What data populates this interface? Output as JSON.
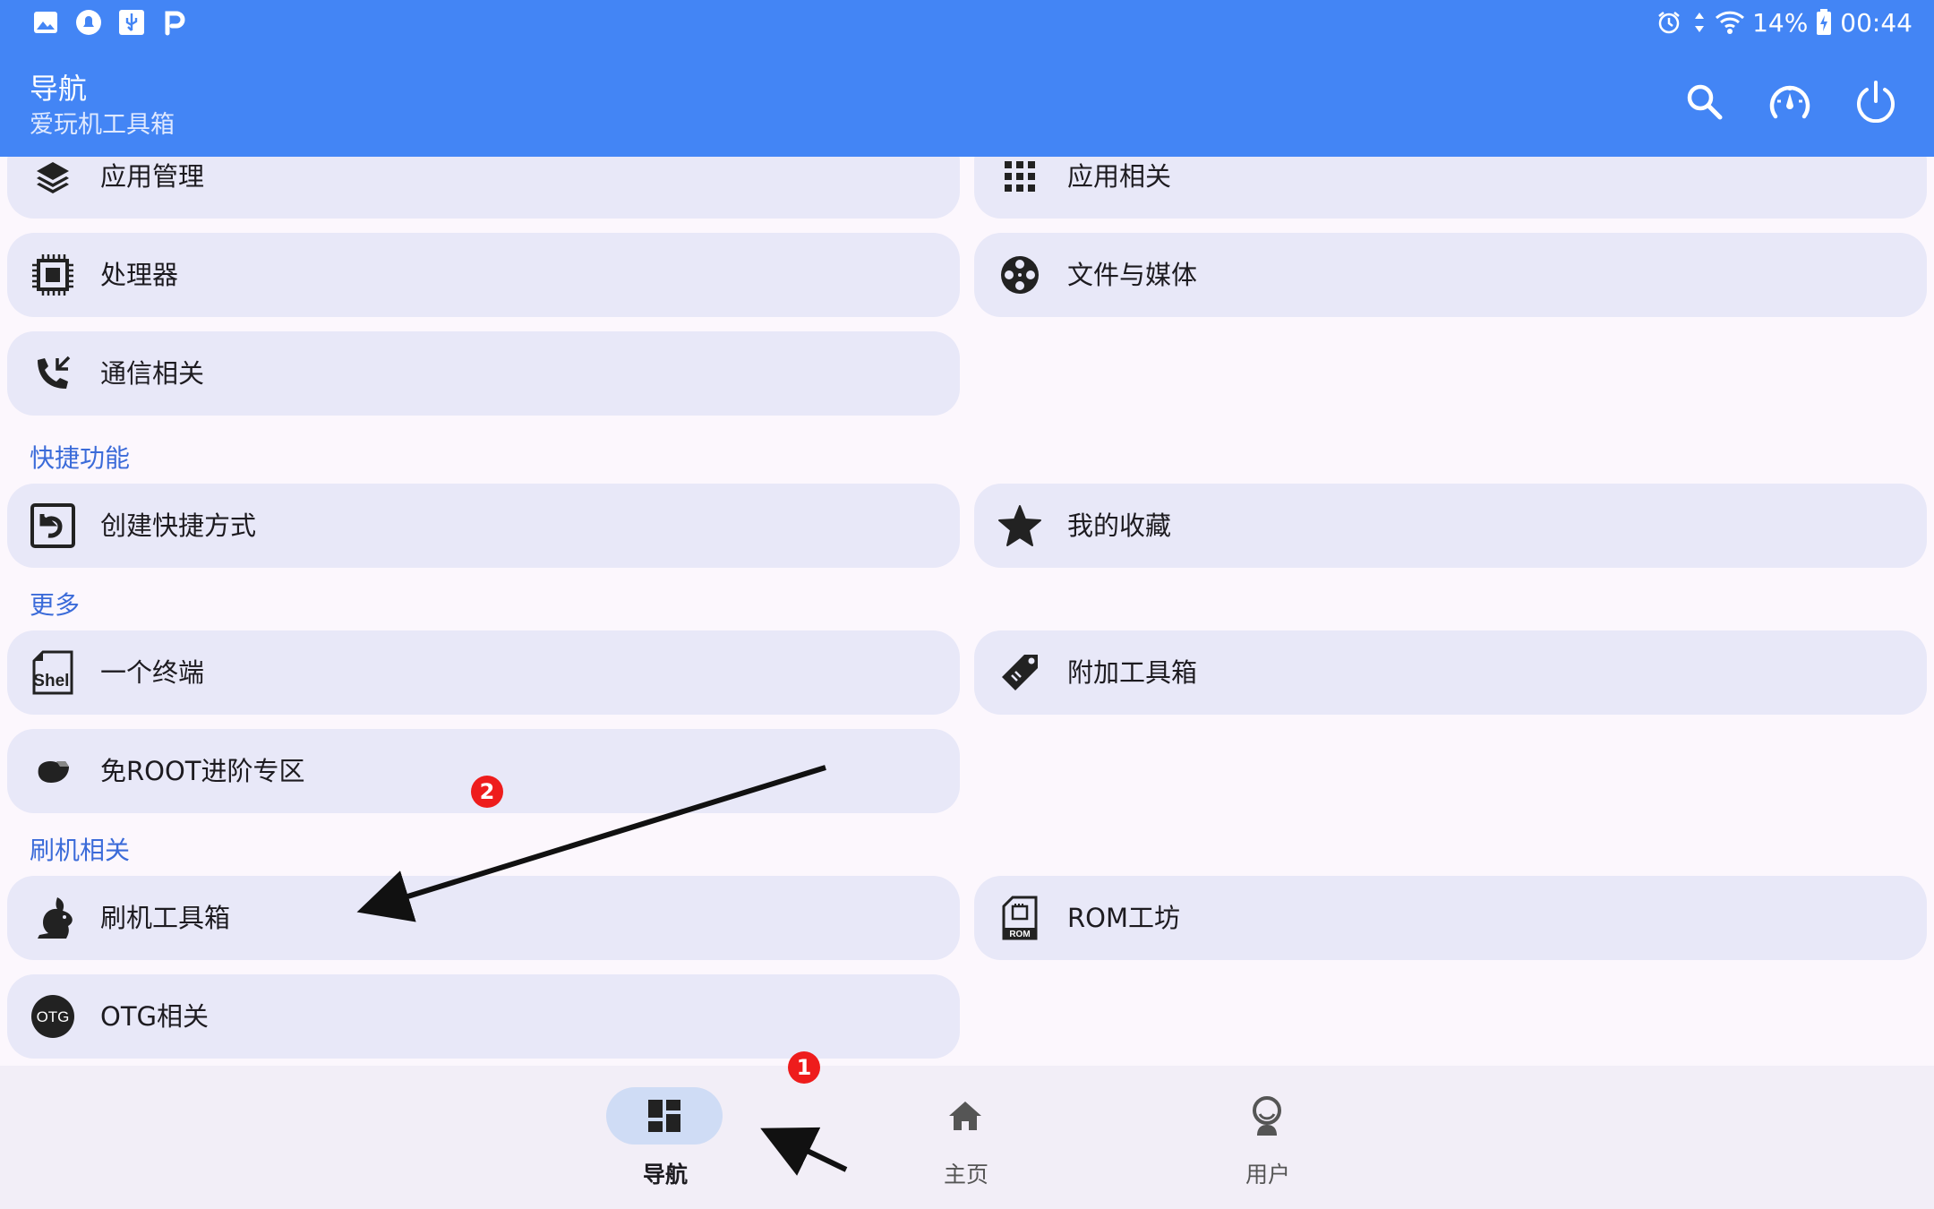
{
  "status_bar": {
    "battery": "14%",
    "time": "00:44",
    "left_icons": [
      "image-icon",
      "notification-bell-icon",
      "usb-icon",
      "p-icon"
    ],
    "right_icons": [
      "alarm-icon",
      "data-arrows-icon",
      "wifi-icon",
      "battery-charging-icon"
    ]
  },
  "app_bar": {
    "title": "导航",
    "subtitle": "爱玩机工具箱",
    "actions": [
      "search-icon",
      "speedometer-icon",
      "power-icon"
    ]
  },
  "sections": {
    "quick": "快捷功能",
    "more": "更多",
    "flash": "刷机相关"
  },
  "items": {
    "app_manage": "应用管理",
    "app_related": "应用相关",
    "processor": "处理器",
    "file_media": "文件与媒体",
    "comm": "通信相关",
    "create_shortcut": "创建快捷方式",
    "favorites": "我的收藏",
    "terminal": "一个终端",
    "extra_tools": "附加工具箱",
    "no_root": "免ROOT进阶专区",
    "flash_tools": "刷机工具箱",
    "rom_workshop": "ROM工坊",
    "otg": "OTG相关"
  },
  "icon_text": {
    "otg": "OTG",
    "rom": "ROM",
    "shell": "Shell"
  },
  "bottom_nav": [
    {
      "label": "导航",
      "icon": "dashboard-icon",
      "active": true
    },
    {
      "label": "主页",
      "icon": "home-icon",
      "active": false
    },
    {
      "label": "用户",
      "icon": "user-icon",
      "active": false
    }
  ],
  "annotations": {
    "badge_1": "1",
    "badge_2": "2"
  },
  "colors": {
    "app_bar": "#4385f5",
    "card": "#e8e8f8",
    "section_title": "#3b6bd9",
    "badge": "#ee1c1c"
  }
}
